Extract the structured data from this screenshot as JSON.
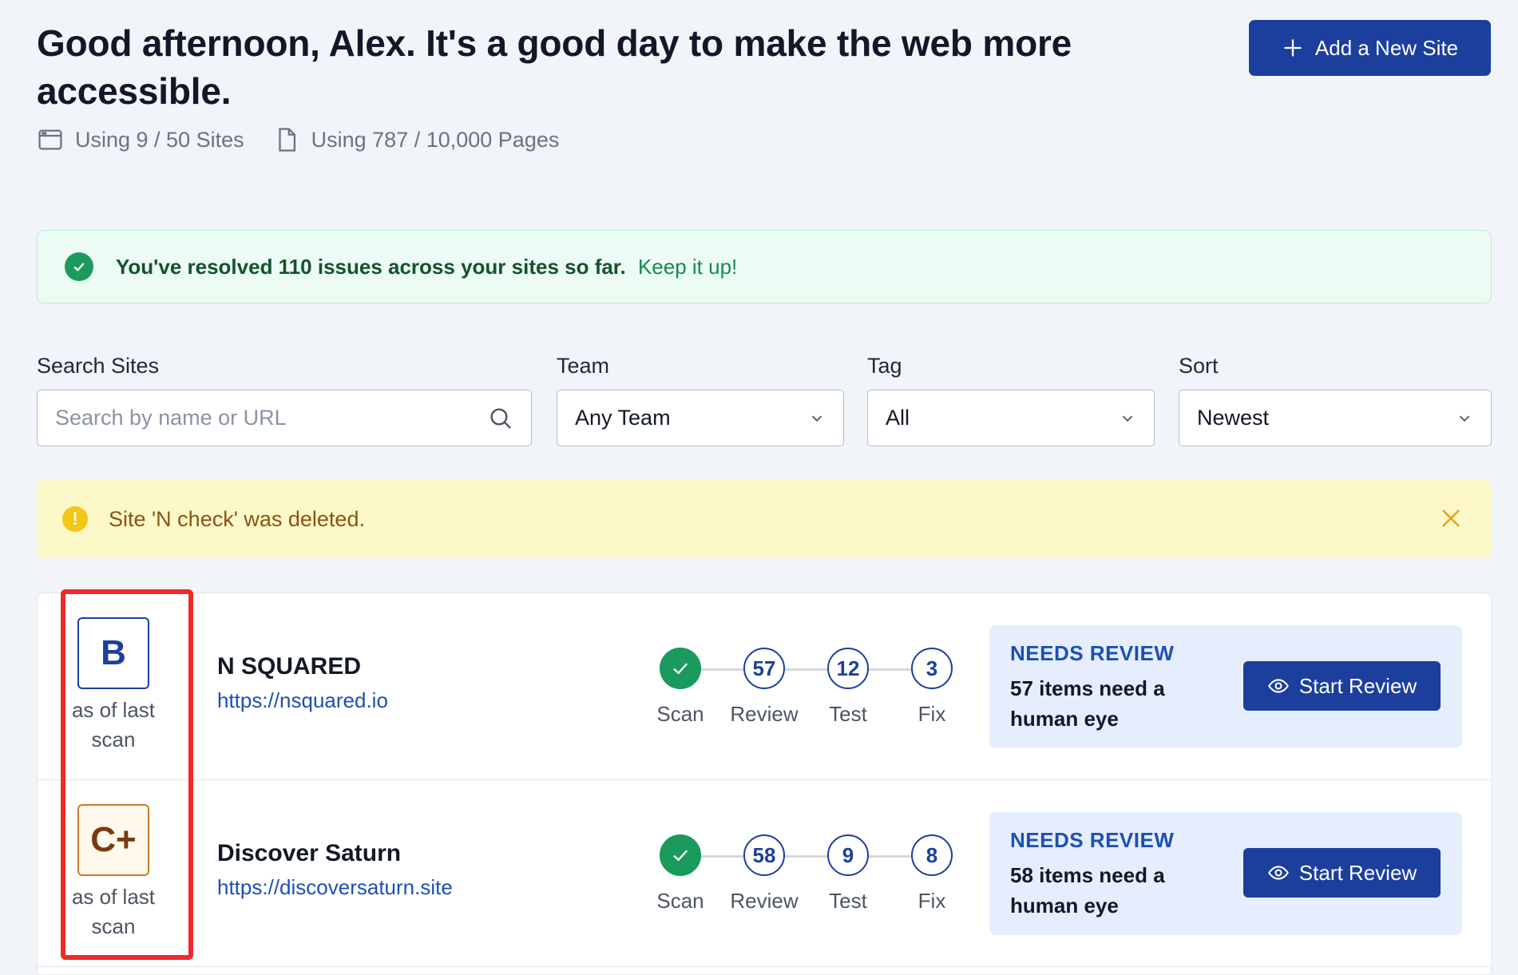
{
  "header": {
    "greeting": "Good afternoon, Alex. It's a good day to make the web more accessible.",
    "sites_usage": "Using 9 / 50 Sites",
    "pages_usage": "Using 787 / 10,000 Pages",
    "add_site_label": "Add a New Site"
  },
  "success_banner": {
    "strong_text": "You've resolved 110 issues across your sites so far.",
    "soft_text": "Keep it up!"
  },
  "filters": {
    "search": {
      "label": "Search Sites",
      "placeholder": "Search by name or URL"
    },
    "team": {
      "label": "Team",
      "value": "Any Team"
    },
    "tag": {
      "label": "Tag",
      "value": "All"
    },
    "sort": {
      "label": "Sort",
      "value": "Newest"
    }
  },
  "warning_banner": {
    "text": "Site 'N check' was deleted."
  },
  "sites": [
    {
      "grade": "B",
      "grade_caption": "as of last scan",
      "name": "N SQUARED",
      "url": "https://nsquared.io",
      "steps": [
        {
          "label": "Scan",
          "value": ""
        },
        {
          "label": "Review",
          "value": "57"
        },
        {
          "label": "Test",
          "value": "12"
        },
        {
          "label": "Fix",
          "value": "3"
        }
      ],
      "status_title": "NEEDS REVIEW",
      "status_text": "57 items need a human eye",
      "action_label": "Start Review"
    },
    {
      "grade": "C+",
      "grade_caption": "as of last scan",
      "name": "Discover Saturn",
      "url": "https://discoversaturn.site",
      "steps": [
        {
          "label": "Scan",
          "value": ""
        },
        {
          "label": "Review",
          "value": "58"
        },
        {
          "label": "Test",
          "value": "9"
        },
        {
          "label": "Fix",
          "value": "8"
        }
      ],
      "status_title": "NEEDS REVIEW",
      "status_text": "58 items need a human eye",
      "action_label": "Start Review"
    }
  ],
  "colors": {
    "primary": "#1c3f9e",
    "success": "#1b9a5e",
    "warning": "#f5c518",
    "highlight": "#ee2a2a"
  }
}
